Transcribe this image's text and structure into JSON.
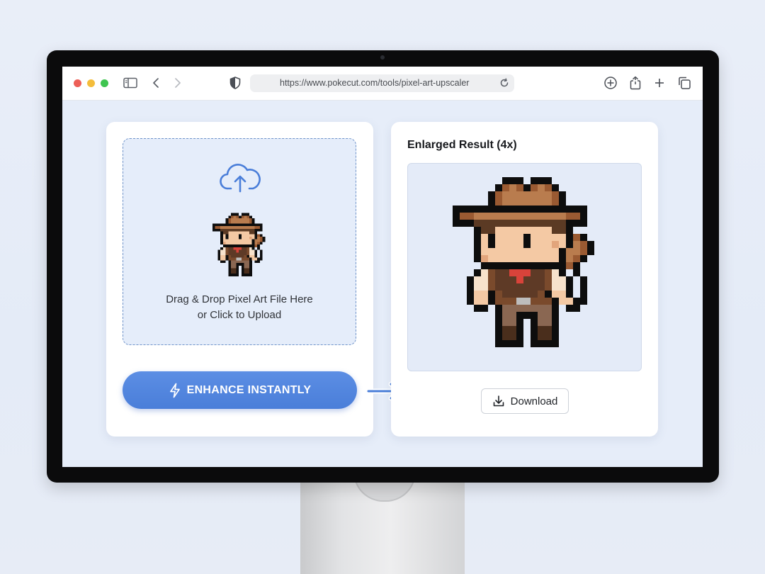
{
  "browser": {
    "url": "https://www.pokecut.com/tools/pixel-art-upscaler",
    "traffic_lights": {
      "close": "#ed5f57",
      "minimize": "#f4bd3b",
      "maximize": "#3fc550"
    }
  },
  "uploader": {
    "drop_line1": "Drag & Drop Pixel Art File Here",
    "drop_line2": "or Click to Upload",
    "enhance_label": "ENHANCE INSTANTLY",
    "accent_color": "#4a7ed9"
  },
  "result": {
    "title": "Enlarged Result (4x)",
    "download_label": "Download"
  },
  "icons": [
    "sidebar-icon",
    "back-icon",
    "forward-icon",
    "shield-icon",
    "reload-icon",
    "download-circle-icon",
    "share-icon",
    "new-tab-icon",
    "tabs-overview-icon",
    "cloud-upload-icon",
    "lightning-icon",
    "arrow-right-icon",
    "download-icon"
  ]
}
